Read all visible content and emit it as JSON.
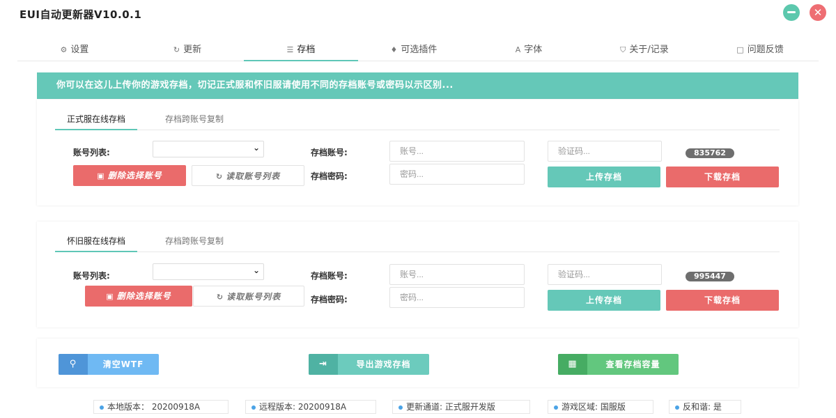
{
  "app": {
    "title": "EUI自动更新器V10.0.1"
  },
  "tabs": [
    {
      "label": "设置",
      "icon": "gear-icon",
      "glyph": "⚙"
    },
    {
      "label": "更新",
      "icon": "refresh-icon",
      "glyph": "↻"
    },
    {
      "label": "存档",
      "icon": "database-icon",
      "glyph": "☰"
    },
    {
      "label": "可选插件",
      "icon": "plug-icon",
      "glyph": "♦"
    },
    {
      "label": "字体",
      "icon": "font-icon",
      "glyph": "A"
    },
    {
      "label": "关于/记录",
      "icon": "shield-icon",
      "glyph": "⛉"
    },
    {
      "label": "问题反馈",
      "icon": "comment-icon",
      "glyph": "□"
    }
  ],
  "active_tab": "存档",
  "notice": "你可以在这儿上传你的游戏存档，切记正式服和怀旧服请使用不同的存档账号或密码以示区别...",
  "official": {
    "tab_active": "正式服在线存档",
    "tab_other": "存档跨账号复制",
    "account_list_label": "账号列表:",
    "account_list_value": "",
    "delete_label": "删除选择账号",
    "read_label": "读取账号列表",
    "save_account_label": "存档账号:",
    "save_account_placeholder": "账号...",
    "save_password_label": "存档密码:",
    "save_password_placeholder": "密码...",
    "captcha_placeholder": "验证码...",
    "captcha_code": "835762",
    "upload_label": "上传存档",
    "download_label": "下载存档"
  },
  "classic": {
    "tab_active": "怀旧服在线存档",
    "tab_other": "存档跨账号复制",
    "account_list_label": "账号列表:",
    "account_list_value": "",
    "delete_label": "删除选择账号",
    "read_label": "读取账号列表",
    "save_account_label": "存档账号:",
    "save_account_placeholder": "账号...",
    "save_password_label": "存档密码:",
    "save_password_placeholder": "密码...",
    "captcha_placeholder": "验证码...",
    "captcha_code": "995447",
    "upload_label": "上传存档",
    "download_label": "下载存档"
  },
  "actions": {
    "clear_wtf": "清空WTF",
    "export_saves": "导出游戏存档",
    "view_capacity": "查看存档容量"
  },
  "status": {
    "local_version": "本地版本： 20200918A",
    "remote_version": "远程版本: 20200918A",
    "channel": "更新通道: 正式服开发版",
    "region": "游戏区域: 国服版",
    "anti_harmony": "反和谐: 是"
  },
  "colors": {
    "accent": "#65c8b8",
    "danger": "#ea6b6b",
    "clear_btn": "#5aa9f0",
    "export_btn": "#5fc7b7",
    "capacity_btn": "#5ac478"
  }
}
